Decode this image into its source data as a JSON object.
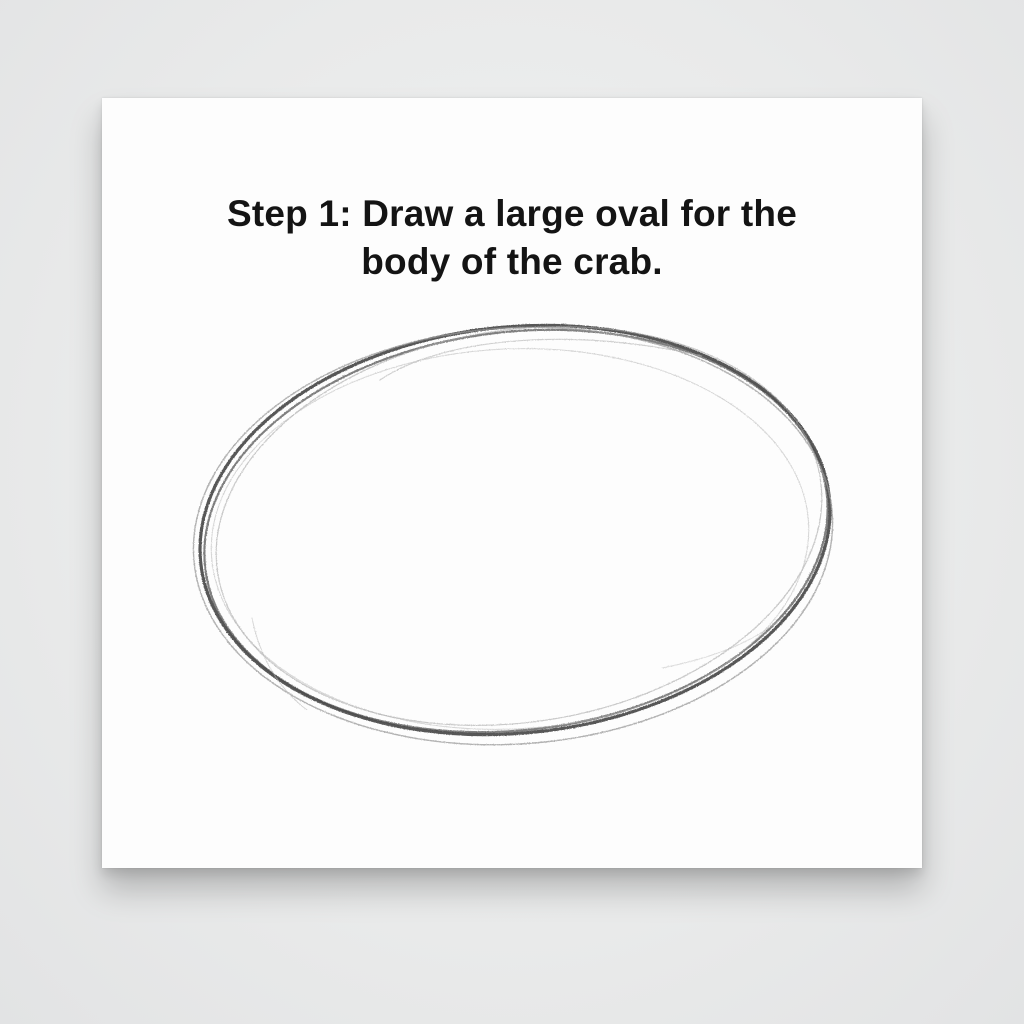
{
  "instruction": {
    "line1": "Step 1: Draw a large oval for the",
    "line2": "body of the crab."
  },
  "colors": {
    "background": "#e8e9ea",
    "paper": "#fdfdfd",
    "text": "#141414",
    "pencil_dark": "#3a3a3a",
    "pencil_light": "#9a9a9a"
  },
  "illustration": {
    "subject": "pencil-sketch-oval"
  }
}
